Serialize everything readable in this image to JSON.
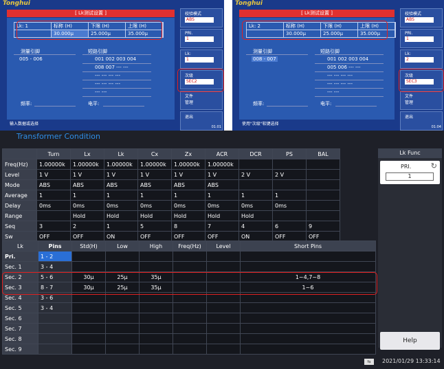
{
  "old_screen_1": {
    "logo": "Tonghui",
    "title": "[ Lk测试设置 ]",
    "lk_label": "Lk:  1",
    "hdr_nominal": "标称 (H)",
    "hdr_lower": "下限 (H)",
    "hdr_upper": "上限 (H)",
    "val_nominal": "30.000μ",
    "val_lower": "25.000μ",
    "val_upper": "35.000μ",
    "measure_pins_label": "测量引脚",
    "short_pins_label": "短路引脚",
    "measure_pins": "005 - 006",
    "short_row1": "001  002  003  004",
    "short_row2": "008  007  ---  ---",
    "dash_row": "---  ---  ---  ---",
    "dash_short": "---  ---",
    "freq_label": "频率:",
    "level_label": "电平:",
    "status": "输入数据或选择",
    "side": [
      {
        "label": "校验模式",
        "value": "ABS"
      },
      {
        "label": "PRI.",
        "value": "1"
      },
      {
        "label": "Lk:",
        "value": "1"
      },
      {
        "label": "次级",
        "value": "SEC2"
      },
      {
        "label": "文件\n管理",
        "value": ""
      },
      {
        "label": "退出",
        "value": ""
      }
    ],
    "clock": "01:01"
  },
  "old_screen_2": {
    "logo": "Tonghui",
    "title": "[ Lk测试设置 ]",
    "lk_label": "Lk:  2",
    "hdr_nominal": "标称 (H)",
    "hdr_lower": "下限 (H)",
    "hdr_upper": "上限 (H)",
    "val_nominal": "30.000μ",
    "val_lower": "25.000μ",
    "val_upper": "35.000μ",
    "measure_pins_label": "测量引脚",
    "short_pins_label": "短路引脚",
    "measure_pins": "008 - 007",
    "short_row1": "001  002  003  004",
    "short_row2": "005  006  ---  ---",
    "dash_row": "---  ---  ---  ---",
    "dash_short": "---  ---",
    "freq_label": "频率:",
    "level_label": "电平:",
    "status": "使用\"次级\"软键选择",
    "side": [
      {
        "label": "校验模式",
        "value": "ABS"
      },
      {
        "label": "PRI.",
        "value": "1"
      },
      {
        "label": "Lk:",
        "value": "2"
      },
      {
        "label": "次级",
        "value": "SEC3"
      },
      {
        "label": "文件\n管理",
        "value": ""
      },
      {
        "label": "退出",
        "value": ""
      }
    ],
    "clock": "01:04"
  },
  "condition": {
    "title": "Transformer Condition",
    "headers": [
      "",
      "Turn",
      "Lx",
      "Lk",
      "Cx",
      "Zx",
      "ACR",
      "DCR",
      "PS",
      "BAL"
    ],
    "rows": [
      [
        "Freq(Hz)",
        "1.00000k",
        "1.00000k",
        "1.00000k",
        "1.00000k",
        "1.00000k",
        "1.00000k",
        "",
        "",
        ""
      ],
      [
        "Level",
        "1 V",
        "1 V",
        "1 V",
        "1 V",
        "1 V",
        "1 V",
        "2 V",
        "2 V",
        ""
      ],
      [
        "Mode",
        "ABS",
        "ABS",
        "ABS",
        "ABS",
        "ABS",
        "ABS",
        "",
        "",
        ""
      ],
      [
        "Average",
        "1",
        "1",
        "1",
        "1",
        "1",
        "1",
        "1",
        "1",
        ""
      ],
      [
        "Delay",
        "0ms",
        "0ms",
        "0ms",
        "0ms",
        "0ms",
        "0ms",
        "0ms",
        "0ms",
        ""
      ],
      [
        "Range",
        "",
        "Hold",
        "Hold",
        "Hold",
        "Hold",
        "Hold",
        "Hold",
        "",
        ""
      ],
      [
        "Seq",
        "3",
        "2",
        "1",
        "5",
        "8",
        "7",
        "4",
        "6",
        "9"
      ],
      [
        "Sw",
        "OFF",
        "OFF",
        "ON",
        "OFF",
        "OFF",
        "OFF",
        "ON",
        "OFF",
        "OFF"
      ]
    ]
  },
  "lk_table": {
    "headers": [
      "Lk",
      "Pins",
      "Std(H)",
      "Low",
      "High",
      "Freq(Hz)",
      "Level",
      "Short Pins"
    ],
    "rows": [
      [
        "Pri.",
        "1 - 2",
        "",
        "",
        "",
        "",
        "",
        ""
      ],
      [
        "Sec. 1",
        "3 - 4",
        "",
        "",
        "",
        "",
        "",
        ""
      ],
      [
        "Sec. 2",
        "5 - 6",
        "30μ",
        "25μ",
        "35μ",
        "",
        "",
        "1~4,7~8"
      ],
      [
        "Sec. 3",
        "8 - 7",
        "30μ",
        "25μ",
        "35μ",
        "",
        "",
        "1~6"
      ],
      [
        "Sec. 4",
        "3 - 6",
        "",
        "",
        "",
        "",
        "",
        ""
      ],
      [
        "Sec. 5",
        "3 - 4",
        "",
        "",
        "",
        "",
        "",
        ""
      ],
      [
        "Sec. 6",
        "",
        "",
        "",
        "",
        "",
        "",
        ""
      ],
      [
        "Sec. 7",
        "",
        "",
        "",
        "",
        "",
        "",
        ""
      ],
      [
        "Sec. 8",
        "",
        "",
        "",
        "",
        "",
        "",
        ""
      ],
      [
        "Sec. 9",
        "",
        "",
        "",
        "",
        "",
        "",
        ""
      ]
    ]
  },
  "right_panel": {
    "title": "Lk Func",
    "pri_label": "PRI.",
    "pri_value": "1",
    "help_label": "Help"
  },
  "status": {
    "usb_icon": "usb-icon",
    "datetime": "2021/01/29 13:33:14"
  },
  "colors": {
    "highlight_box": "#e02020",
    "title_blue": "#2f8fe8",
    "selected_pin": "#2a6fd6"
  }
}
